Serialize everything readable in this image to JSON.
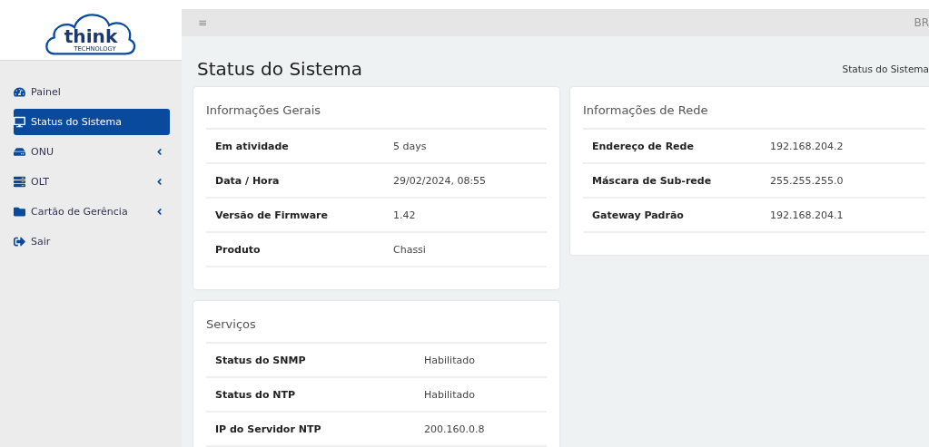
{
  "logo": {
    "text": "think",
    "subtext": "TECHNOLOGY"
  },
  "sidebar": {
    "items": [
      {
        "label": "Painel",
        "kind": "dashboard",
        "selected": false,
        "expandable": false
      },
      {
        "label": "Status do Sistema",
        "kind": "monitor",
        "selected": true,
        "expandable": false
      },
      {
        "label": "ONU",
        "kind": "drive",
        "selected": false,
        "expandable": true
      },
      {
        "label": "OLT",
        "kind": "server",
        "selected": false,
        "expandable": true
      },
      {
        "label": "Cartão de Gerência",
        "kind": "folder",
        "selected": false,
        "expandable": true
      },
      {
        "label": "Sair",
        "kind": "logout",
        "selected": false,
        "expandable": false
      }
    ]
  },
  "topbar": {
    "menu_icon": "≡",
    "language": "BR"
  },
  "page": {
    "title": "Status do Sistema",
    "breadcrumb": "Status do Sistema"
  },
  "cards": [
    {
      "title": "Informações Gerais",
      "rows": [
        {
          "label": "Em atividade",
          "value": "5 days"
        },
        {
          "label": "Data / Hora",
          "value": "29/02/2024, 08:55"
        },
        {
          "label": "Versão de Firmware",
          "value": "1.42"
        },
        {
          "label": "Produto",
          "value": "Chassi"
        }
      ]
    },
    {
      "title": "Informações de Rede",
      "rows": [
        {
          "label": "Endereço de Rede",
          "value": "192.168.204.2"
        },
        {
          "label": "Máscara de Sub-rede",
          "value": "255.255.255.0"
        },
        {
          "label": "Gateway Padrão",
          "value": "192.168.204.1"
        }
      ]
    },
    {
      "title": "Serviços",
      "rows": [
        {
          "label": "Status do SNMP",
          "value": "Habilitado"
        },
        {
          "label": "Status do NTP",
          "value": "Habilitado"
        },
        {
          "label": "IP do Servidor NTP",
          "value": "200.160.0.8"
        }
      ]
    }
  ]
}
